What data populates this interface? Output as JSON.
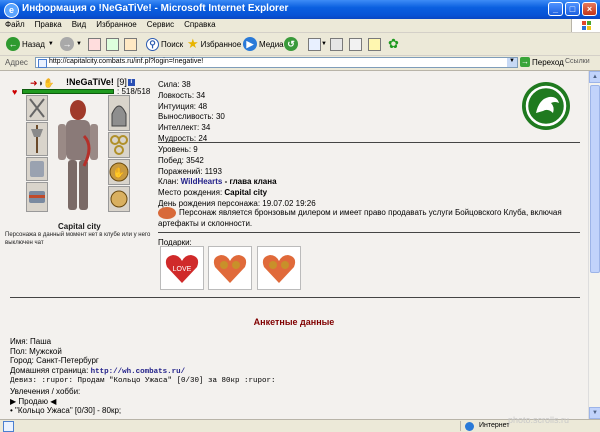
{
  "window": {
    "title": "Информация о !NeGaTiVe! - Microsoft Internet Explorer"
  },
  "menu": [
    "Файл",
    "Правка",
    "Вид",
    "Избранное",
    "Сервис",
    "Справка"
  ],
  "toolbar": {
    "back": "Назад",
    "search": "Поиск",
    "favorites": "Избранное",
    "media": "Медиа"
  },
  "address": {
    "label": "Адрес",
    "url": "http://capitalcity.combats.ru/inf.pl?login=!negative!",
    "go": "Переход",
    "links": "Ссылки"
  },
  "character": {
    "name": "!NeGaTiVe!",
    "level": "[9]",
    "hp": ": 518/518",
    "city": "Capital city",
    "note": "Персонажа в данный момент нет в клубе или у него выключен чат"
  },
  "stats": [
    "Сила: 38",
    "Ловкость: 34",
    "Интуиция: 48",
    "Выносливость: 30",
    "Интеллект: 34",
    "Мудрость: 24"
  ],
  "info": {
    "level": "Уровень: 9",
    "wins": "Побед: 3542",
    "losses": "Поражений: 1193",
    "clan_label": "Клан: ",
    "clan_name": "WildHearts",
    "clan_role": " - глава клана",
    "birthplace_label": "Место рождения: ",
    "birthplace": "Capital city",
    "birthday": "День рождения персонажа: 19.07.02 19:26"
  },
  "dealer": "Персонаж является бронзовым дилером и имеет право продавать услуги Бойцовского Клуба, включая артефакты и склонности.",
  "gifts": {
    "label": "Подарки:"
  },
  "anketa": {
    "title": "Анкетные данные",
    "name": "Имя: Паша",
    "gender": "Пол: Мужской",
    "city": "Город: Санкт-Петербург",
    "homepage_label": "Домашняя страница: ",
    "homepage": "http://wh.combats.ru/",
    "motto": "Девиз: :rupor: Продам \"Кольцо Ужаса\" [0/30] за 80кр :rupor:",
    "hobby": "Увлечения / хобби:",
    "sell": "▶ Продаю ◀",
    "item1": "• \"Кольцо Ужаса\" [0/30] - 80кр;"
  },
  "status": {
    "zone": "Интернет"
  },
  "watermark": "photo.scrolls.ru"
}
